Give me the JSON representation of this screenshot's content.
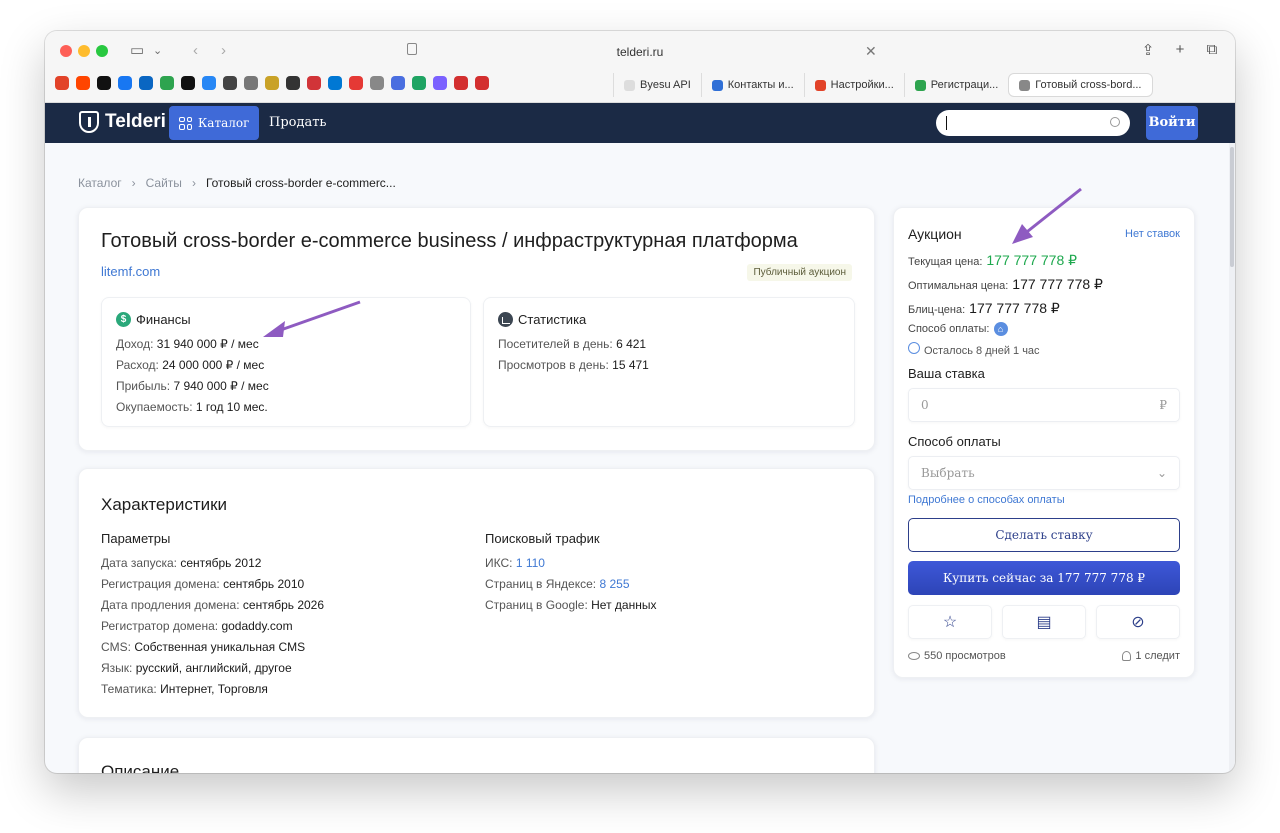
{
  "browser": {
    "url": "telderi.ru",
    "favorites_colors": [
      "#e24329",
      "#ff4500",
      "#111111",
      "#1877f2",
      "#0a66c2",
      "#2ea44f",
      "#111111",
      "#2787f5",
      "#444444",
      "#777777",
      "#c9a227",
      "#333333",
      "#d13438",
      "#0078d4",
      "#e53935",
      "#888888",
      "#4a6ee0",
      "#1fa463",
      "#7b61ff",
      "#d32f2f",
      "#d32f2f"
    ],
    "tabs": [
      {
        "label": "Byesu API",
        "color": "#dddddd"
      },
      {
        "label": "Контакты и...",
        "color": "#2f6fd6"
      },
      {
        "label": "Настройки...",
        "color": "#e24329"
      },
      {
        "label": "Регистраци...",
        "color": "#2ea44f"
      },
      {
        "label": "Готовый cross-bord...",
        "color": "#888888"
      }
    ]
  },
  "header": {
    "logo": "Telderi",
    "catalog_label": "Каталог",
    "sell_label": "Продать",
    "search_value": "",
    "login_label": "Войти"
  },
  "breadcrumb": {
    "items": [
      "Каталог",
      "Сайты",
      "Готовый cross-border e-commerc..."
    ]
  },
  "listing": {
    "title": "Готовый cross-border e-commerce business / инфраструктурная платформа",
    "domain": "litemf.com",
    "badge": "Публичный аукцион",
    "finance": {
      "title": "Финансы",
      "income_label": "Доход:",
      "income_value": "31 940 000 ₽ / мес",
      "expense_label": "Расход:",
      "expense_value": "24 000 000 ₽ / мес",
      "profit_label": "Прибыль:",
      "profit_value": "7 940 000 ₽ / мес",
      "payback_label": "Окупаемость:",
      "payback_value": "1 год 10 мес."
    },
    "stats": {
      "title": "Статистика",
      "visitors_label": "Посетителей в день:",
      "visitors_value": "6 421",
      "views_label": "Просмотров в день:",
      "views_value": "15 471"
    }
  },
  "characteristics": {
    "title": "Характеристики",
    "params_title": "Параметры",
    "params": [
      {
        "label": "Дата запуска:",
        "value": "сентябрь 2012"
      },
      {
        "label": "Регистрация домена:",
        "value": "сентябрь 2010"
      },
      {
        "label": "Дата продления домена:",
        "value": "сентябрь 2026"
      },
      {
        "label": "Регистратор домена:",
        "value": "godaddy.com"
      },
      {
        "label": "CMS:",
        "value": "Собственная уникальная CMS"
      },
      {
        "label": "Язык:",
        "value": "русский, английский, другое"
      },
      {
        "label": "Тематика:",
        "value": "Интернет, Торговля"
      }
    ],
    "traffic_title": "Поисковый трафик",
    "traffic": [
      {
        "label": "ИКС:",
        "value": "1 110"
      },
      {
        "label": "Страниц в Яндексе:",
        "value": "8 255"
      },
      {
        "label": "Страниц в Google:",
        "value": "Нет данных"
      }
    ]
  },
  "description": {
    "title": "Описание"
  },
  "auction": {
    "title": "Аукцион",
    "no_bids": "Нет ставок",
    "current_price_label": "Текущая цена:",
    "current_price": "177 777 778 ₽",
    "optimal_price_label": "Оптимальная цена:",
    "optimal_price": "177 777 778 ₽",
    "blitz_price_label": "Блиц-цена:",
    "blitz_price": "177 777 778 ₽",
    "payment_method_label": "Способ оплаты:",
    "time_left": "Осталось 8 дней 1 час",
    "your_bid_label": "Ваша ставка",
    "bid_placeholder": "0",
    "currency": "₽",
    "payment_select_label": "Способ оплаты",
    "payment_select_value": "Выбрать",
    "payment_more": "Подробнее о способах оплаты",
    "bid_button": "Сделать ставку",
    "buy_button": "Купить сейчас за 177 777 778 ₽",
    "views": "550 просмотров",
    "followers": "1 следит"
  },
  "annotation_color": "#8e5bc1"
}
